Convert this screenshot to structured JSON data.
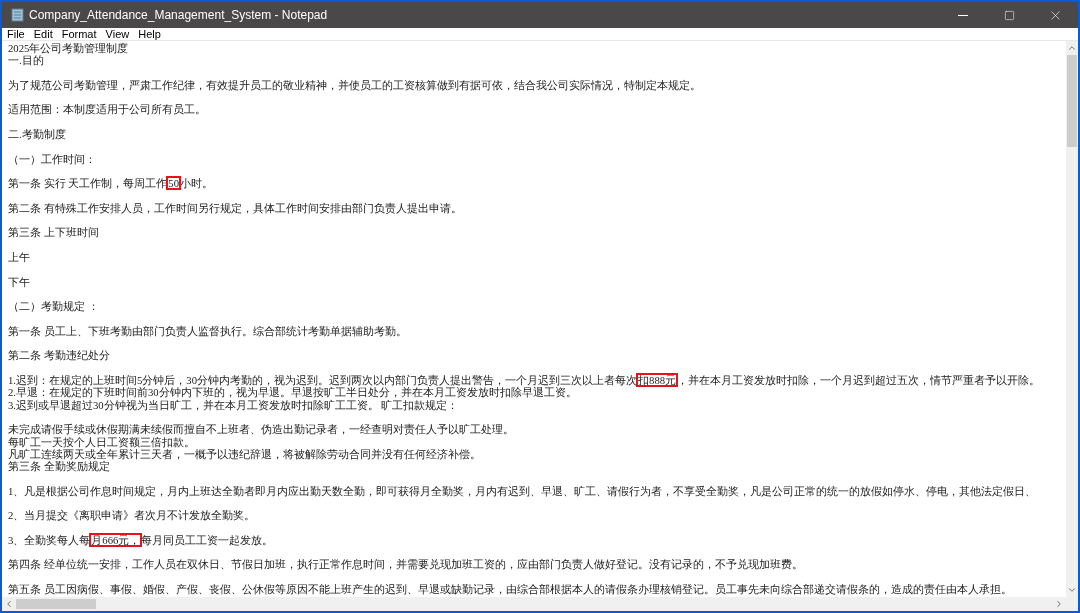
{
  "window": {
    "title": "Company_Attendance_Management_System - Notepad"
  },
  "menu": [
    "File",
    "Edit",
    "Format",
    "View",
    "Help"
  ],
  "lines": [
    {
      "blank_before": false,
      "segments": [
        {
          "text": "2025年公司考勤管理制度",
          "boxed": false
        }
      ]
    },
    {
      "blank_before": false,
      "segments": [
        {
          "text": "一.目的",
          "boxed": false
        }
      ]
    },
    {
      "blank_before": true,
      "segments": [
        {
          "text": "为了规范公司考勤管理，严肃工作纪律，有效提升员工的敬业精神，并使员工的工资核算做到有据可依，结合我公司实际情况，特制定本规定。",
          "boxed": false
        }
      ]
    },
    {
      "blank_before": true,
      "segments": [
        {
          "text": "适用范围：本制度适用于公司所有员工。",
          "boxed": false
        }
      ]
    },
    {
      "blank_before": true,
      "segments": [
        {
          "text": "二.考勤制度",
          "boxed": false
        }
      ]
    },
    {
      "blank_before": true,
      "segments": [
        {
          "text": "（一）工作时间：",
          "boxed": false
        }
      ]
    },
    {
      "blank_before": true,
      "segments": [
        {
          "text": "第一条 实行 天工作制，每周工作",
          "boxed": false
        },
        {
          "text": "50",
          "boxed": true
        },
        {
          "text": "小时。",
          "boxed": false
        }
      ]
    },
    {
      "blank_before": true,
      "segments": [
        {
          "text": "第二条 有特殊工作安排人员，工作时间另行规定，具体工作时间安排由部门负责人提出申请。",
          "boxed": false
        }
      ]
    },
    {
      "blank_before": true,
      "segments": [
        {
          "text": "第三条 上下班时间",
          "boxed": false
        }
      ]
    },
    {
      "blank_before": true,
      "segments": [
        {
          "text": "上午",
          "boxed": false
        }
      ]
    },
    {
      "blank_before": true,
      "segments": [
        {
          "text": "下午",
          "boxed": false
        }
      ]
    },
    {
      "blank_before": true,
      "segments": [
        {
          "text": "（二）考勤规定 ：",
          "boxed": false
        }
      ]
    },
    {
      "blank_before": true,
      "segments": [
        {
          "text": "第一条 员工上、下班考勤由部门负责人监督执行。综合部统计考勤单据辅助考勤。",
          "boxed": false
        }
      ]
    },
    {
      "blank_before": true,
      "segments": [
        {
          "text": "第二条 考勤违纪处分",
          "boxed": false
        }
      ]
    },
    {
      "blank_before": true,
      "segments": [
        {
          "text": "1.迟到：在规定的上班时间5分钟后，30分钟内考勤的，视为迟到。迟到两次以内部门负责人提出警告，一个月迟到三次以上者每次",
          "boxed": false
        },
        {
          "text": "扣888元",
          "boxed": true
        },
        {
          "text": "，并在本月工资发放时扣除，一个月迟到超过五次，情节严重者予以开除。",
          "boxed": false
        }
      ]
    },
    {
      "blank_before": false,
      "segments": [
        {
          "text": "2.早退：在规定的下班时间前30分钟内下班的，视为早退。早退按旷工半日处分，并在本月工资发放时扣除早退工资。",
          "boxed": false
        }
      ]
    },
    {
      "blank_before": false,
      "segments": [
        {
          "text": "3.迟到或早退超过30分钟视为当日旷工，并在本月工资发放时扣除旷工工资。 旷工扣款规定：",
          "boxed": false
        }
      ]
    },
    {
      "blank_before": true,
      "segments": [
        {
          "text": "未完成请假手续或休假期满未续假而擅自不上班者、伪造出勤记录者，一经查明对责任人予以旷工处理。",
          "boxed": false
        }
      ]
    },
    {
      "blank_before": false,
      "segments": [
        {
          "text": "每旷工一天按个人日工资额三倍扣款。",
          "boxed": false
        }
      ]
    },
    {
      "blank_before": false,
      "segments": [
        {
          "text": "凡旷工连续两天或全年累计三天者，一概予以违纪辞退，将被解除劳动合同并没有任何经济补偿。",
          "boxed": false
        }
      ]
    },
    {
      "blank_before": false,
      "segments": [
        {
          "text": "第三条 全勤奖励规定",
          "boxed": false
        }
      ]
    },
    {
      "blank_before": true,
      "segments": [
        {
          "text": "1、凡是根据公司作息时间规定，月内上班达全勤者即月内应出勤天数全勤，即可获得月全勤奖，月内有迟到、早退、旷工、请假行为者，不享受全勤奖，凡是公司正常的统一的放假如停水、停电，其他法定假日、",
          "boxed": false
        }
      ]
    },
    {
      "blank_before": true,
      "segments": [
        {
          "text": "2、当月提交《离职申请》者次月不计发放全勤奖。",
          "boxed": false
        }
      ]
    },
    {
      "blank_before": true,
      "segments": [
        {
          "text": "3、全勤奖每人每",
          "boxed": false
        },
        {
          "text": "月666元，",
          "boxed": true
        },
        {
          "text": "每月同员工工资一起发放。",
          "boxed": false
        }
      ]
    },
    {
      "blank_before": true,
      "segments": [
        {
          "text": "第四条 经单位统一安排，工作人员在双休日、节假日加班，执行正常作息时间，并需要兑现加班工资的，应由部门负责人做好登记。没有记录的，不予兑现加班费。",
          "boxed": false
        }
      ]
    },
    {
      "blank_before": true,
      "segments": [
        {
          "text": "第五条 员工因病假、事假、婚假、产假、丧假、公休假等原因不能上班产生的迟到、早退或缺勤记录，由综合部根据本人的请假条办理核销登记。员工事先未向综合部递交请假条的，造成的责任由本人承担。",
          "boxed": false
        }
      ]
    }
  ]
}
